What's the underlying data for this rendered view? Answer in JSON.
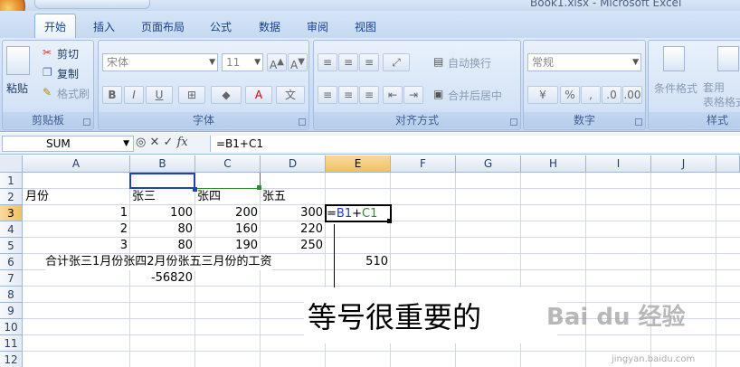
{
  "window": {
    "title": "Book1.xlsx - Microsoft Excel"
  },
  "tabs": [
    "开始",
    "插入",
    "页面布局",
    "公式",
    "数据",
    "审阅",
    "视图"
  ],
  "ribbon": {
    "clipboard": {
      "paste": "粘贴",
      "cut": "剪切",
      "copy": "复制",
      "format_painter": "格式刷",
      "label": "剪贴板"
    },
    "font": {
      "name": "宋体",
      "size": "11",
      "bold": "B",
      "italic": "I",
      "underline": "U",
      "label": "字体"
    },
    "alignment": {
      "wrap": "自动换行",
      "merge": "合并后居中",
      "label": "对齐方式"
    },
    "number": {
      "format": "常规",
      "percent": "%",
      "comma": ",",
      "label": "数字"
    },
    "styles": {
      "conditional": "条件格式",
      "table": "套用\n表格格式",
      "label": "样式"
    }
  },
  "formula_bar": {
    "name_box": "SUM",
    "fx": "fx",
    "formula": "=B1+C1"
  },
  "grid": {
    "columns": [
      "A",
      "B",
      "C",
      "D",
      "E",
      "F",
      "G",
      "H",
      "I",
      "J"
    ],
    "rows": [
      "1",
      "2",
      "3",
      "4",
      "5",
      "6",
      "7",
      "8",
      "9",
      "10",
      "11",
      "12"
    ],
    "cells": {
      "A2": "月份",
      "B2": "张三",
      "C2": "张四",
      "D2": "张五",
      "A3": "1",
      "B3": "100",
      "C3": "200",
      "D3": "300",
      "E3_ref1": "B1",
      "E3_ref2": "C1",
      "E3_eq": "=",
      "E3_plus": "+",
      "A4": "2",
      "B4": "80",
      "C4": "160",
      "D4": "220",
      "A5": "3",
      "B5": "80",
      "C5": "190",
      "D5": "250",
      "A6": "合计张三1月份张四2月份张五三月份的工资",
      "E6": "510",
      "B7": "-56820"
    }
  },
  "annotation": {
    "text": "等号很重要的"
  },
  "watermark": {
    "text": "Bai du 经验",
    "sub": "jingyan.baidu.com"
  },
  "colors": {
    "ref_blue": "#1f3fbf",
    "ref_green": "#2e8b2e",
    "selected_header": "#f1c15f"
  }
}
